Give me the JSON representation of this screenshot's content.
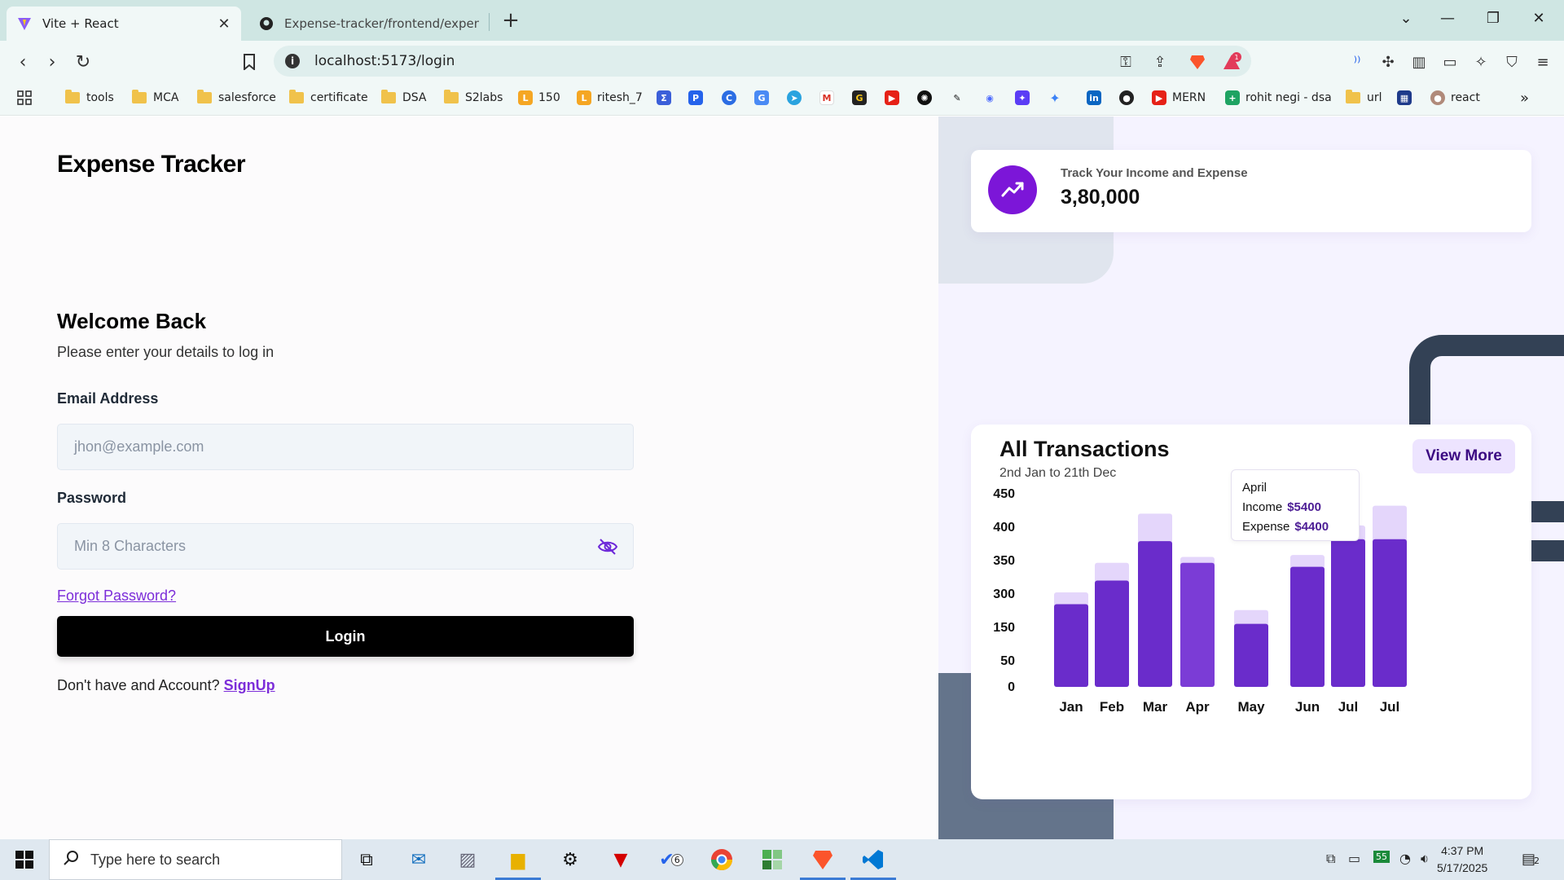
{
  "browser": {
    "tabs": [
      {
        "title": "Vite + React",
        "active": true
      },
      {
        "title": "Expense-tracker/frontend/expense-",
        "active": false
      }
    ],
    "url": "localhost:5173/login",
    "notification_count": "1",
    "bookmarks": [
      "tools",
      "MCA",
      "salesforce",
      "certificate",
      "DSA",
      "S2labs",
      "150",
      "ritesh_7",
      "MERN",
      "rohit negi - dsa",
      "url",
      "react"
    ]
  },
  "login": {
    "brand": "Expense Tracker",
    "heading": "Welcome Back",
    "subheading": "Please enter your details to log in",
    "email_label": "Email Address",
    "email_placeholder": "jhon@example.com",
    "password_label": "Password",
    "password_placeholder": "Min 8 Characters",
    "forgot": "Forgot Password?",
    "login_button": "Login",
    "signup_prompt": "Don't have and Account?",
    "signup_link": "SignUp"
  },
  "stat_card": {
    "label": "Track Your Income and Expense",
    "value": "3,80,000"
  },
  "transactions": {
    "title": "All Transactions",
    "subtitle": "2nd Jan to 21th Dec",
    "view_more": "View More",
    "tooltip": {
      "month": "April",
      "income_label": "Income",
      "income_value": "$5400",
      "expense_label": "Expense",
      "expense_value": "$4400"
    }
  },
  "chart_data": {
    "type": "bar",
    "categories": [
      "Jan",
      "Feb",
      "Mar",
      "Apr",
      "May",
      "Jun",
      "Jul",
      "Jul"
    ],
    "y_ticks": [
      "450",
      "400",
      "350",
      "300",
      "150",
      "50",
      "0"
    ],
    "series": [
      {
        "name": "Income",
        "values": [
          240,
          315,
          440,
          330,
          195,
          335,
          410,
          460
        ]
      },
      {
        "name": "Expense",
        "values": [
          210,
          270,
          370,
          315,
          160,
          305,
          375,
          375
        ]
      }
    ],
    "colors": {
      "income": "#e4d6fb",
      "expense": "#6a2ccb"
    }
  },
  "taskbar": {
    "search_placeholder": "Type here to search",
    "time": "4:37 PM",
    "date": "5/17/2025",
    "todo_badge": "6",
    "notif_badge": "2"
  }
}
